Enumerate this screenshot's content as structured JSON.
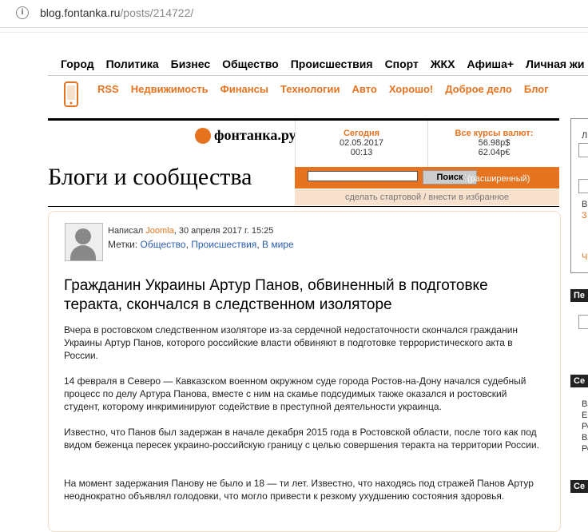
{
  "browser": {
    "url_host": "blog.fontanka.ru",
    "url_path": "/posts/214722/"
  },
  "nav_primary": [
    "Город",
    "Политика",
    "Бизнес",
    "Общество",
    "Происшествия",
    "Спорт",
    "ЖКХ",
    "Афиша+",
    "Личная жи"
  ],
  "nav_secondary": [
    "RSS",
    "Недвижимость",
    "Финансы",
    "Технологии",
    "Авто",
    "Хорошо!",
    "Доброе дело",
    "Блог"
  ],
  "header": {
    "logo": "фонтанка.ру",
    "section_title": "Блоги и сообщества",
    "today_label": "Сегодня",
    "today_date": "02.05.2017",
    "today_time": "00:13",
    "rates_label": "Все курсы валют:",
    "rate_usd": "56.98р$",
    "rate_eur": "62.04р€",
    "search_button": "Поиск",
    "search_advanced": "(расширенный)",
    "start_links": "сделать стартовой / внести в избранное"
  },
  "post": {
    "author_prefix": "Написал",
    "author": "Joomla",
    "date": ", 30 апреля 2017 г. 15:25",
    "tags_label": "Метки:",
    "tags": [
      "Общество",
      "Происшествия",
      "В мире"
    ],
    "title": "Гражданин Украины Артур Панов, обвиненный в подготовке теракта, скончался в следственном изоляторе",
    "paragraphs": [
      "Вчера в ростовском следственном изоляторе из-за сердечной недостаточности скончался гражданин Украины Артур Панов, которого российские власти обвиняют в подготовке террористического акта в России.",
      "14 февраля в Северо — Кавказском военном окружном суде города Ростов-на-Дону начался судебный процесс по делу Артура Панова, вместе с ним на скамье подсудимых также оказался и ростовский студент, которому инкриминируют содействие в преступной деятельности украинца.",
      "Известно, что Панов был задержан в начале декабря 2015 года в Ростовской области, после того как под видом беженца пересек украино-российскую границу с целью совершения теракта на территории России.",
      "На момент задержания Панову не было и 18 — ти лет. Известно, что находясь под стражей Панов Артур неоднократно объявлял голодовки, что могло привести к резкому ухудшению состояния здоровья."
    ]
  },
  "right_column": {
    "letters": [
      "Л",
      "В",
      "З",
      "Ч",
      "Ва",
      "Eu",
      "Ро",
      "Вл",
      "Ро"
    ],
    "headers": [
      "Пе",
      "Се",
      "Се"
    ]
  },
  "colors": {
    "accent": "#e6731f"
  }
}
